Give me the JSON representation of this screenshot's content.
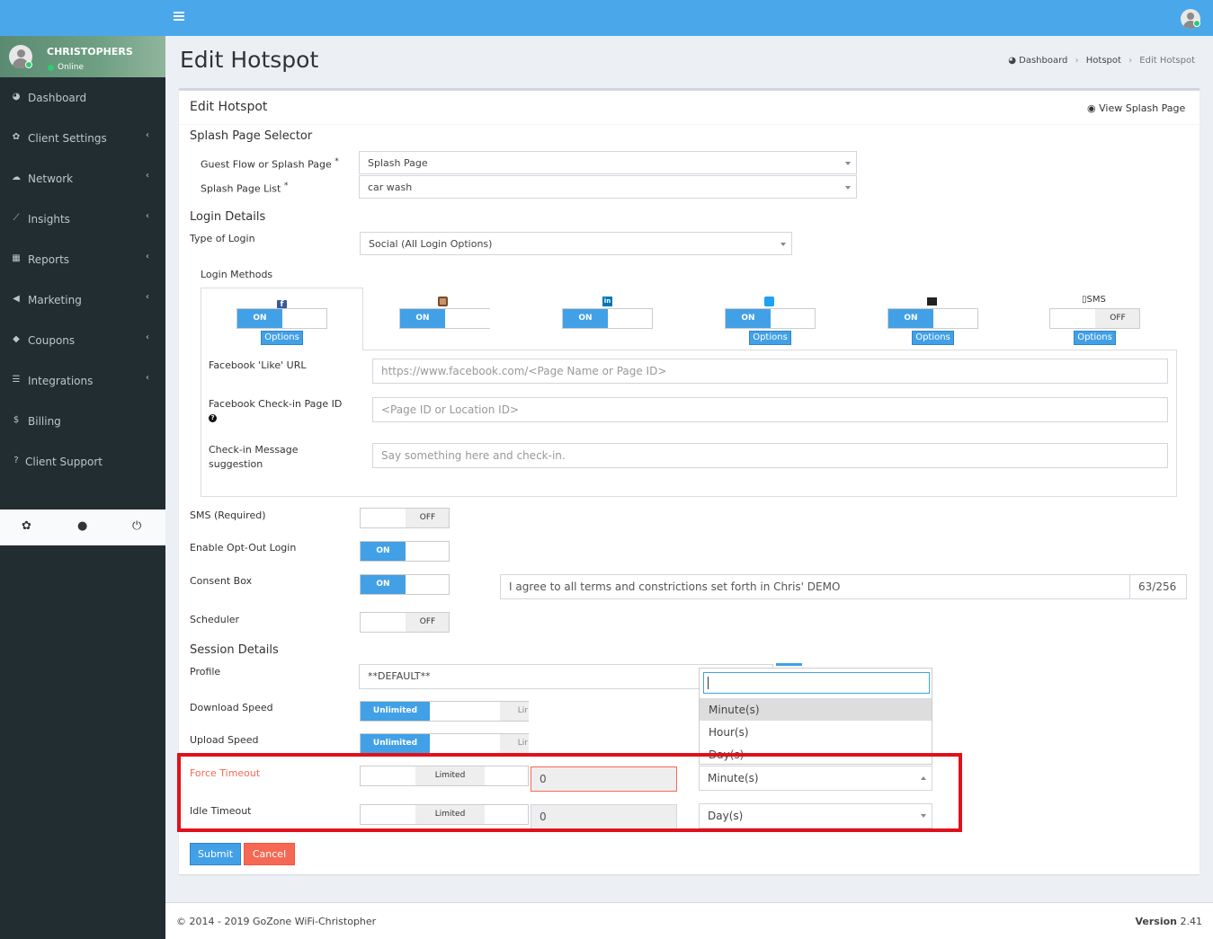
{
  "topbar": {
    "menu_icon": "hamburger-icon",
    "avatar_icon": "user-avatar-icon"
  },
  "sidebar": {
    "user": {
      "name": "CHRISTOPHERS",
      "status": "Online"
    },
    "items": [
      {
        "label": "Dashboard",
        "icon": "dashboard-icon",
        "submenu": false
      },
      {
        "label": "Client Settings",
        "icon": "gear-icon",
        "submenu": true
      },
      {
        "label": "Network",
        "icon": "cloud-icon",
        "submenu": true
      },
      {
        "label": "Insights",
        "icon": "line-chart-icon",
        "submenu": true
      },
      {
        "label": "Reports",
        "icon": "table-icon",
        "submenu": true
      },
      {
        "label": "Marketing",
        "icon": "bullhorn-icon",
        "submenu": true
      },
      {
        "label": "Coupons",
        "icon": "tag-icon",
        "submenu": true
      },
      {
        "label": "Integrations",
        "icon": "list-icon",
        "submenu": true
      },
      {
        "label": "Billing",
        "icon": "dollar-icon",
        "submenu": false
      },
      {
        "label": "Client Support",
        "icon": "question-icon",
        "submenu": false
      }
    ],
    "chevron": "‹",
    "bottom_icons": [
      "gear-icon",
      "user-icon",
      "power-icon"
    ]
  },
  "page": {
    "title": "Edit Hotspot",
    "breadcrumb": {
      "home": "Dashboard",
      "middle": "Hotspot",
      "current": "Edit Hotspot",
      "sep": "›"
    }
  },
  "form": {
    "box_title": "Edit Hotspot",
    "view_splash": "View Splash Page",
    "splash_selector": {
      "heading": "Splash Page Selector",
      "guest_flow_label": "Guest Flow or Splash Page",
      "guest_flow_value": "Splash Page",
      "splash_list_label": "Splash Page List",
      "splash_list_value": "car wash",
      "required_mark": "*"
    },
    "login_details": {
      "heading": "Login Details",
      "type_label": "Type of Login",
      "type_value": "Social (All Login Options)",
      "methods_label": "Login Methods"
    },
    "methods": [
      {
        "name": "facebook",
        "state": "ON",
        "options": "Options",
        "has_options": true
      },
      {
        "name": "instagram",
        "state": "ON",
        "options": "",
        "has_options": false
      },
      {
        "name": "linkedin",
        "state": "ON",
        "options": "",
        "has_options": false
      },
      {
        "name": "twitter",
        "state": "ON",
        "options": "Options",
        "has_options": true
      },
      {
        "name": "email",
        "state": "ON",
        "options": "Options",
        "has_options": true
      },
      {
        "name": "sms",
        "label": "SMS",
        "state": "OFF",
        "options": "Options",
        "has_options": true
      }
    ],
    "facebook": {
      "like_url_label": "Facebook 'Like' URL",
      "like_url_placeholder": "https://www.facebook.com/<Page Name or Page ID>",
      "checkin_label": "Facebook Check-in Page ID",
      "checkin_placeholder": "<Page ID or Location ID>",
      "message_label_1": "Check-in Message",
      "message_label_2": "suggestion",
      "message_placeholder": "Say something here and check-in."
    },
    "sms_required": {
      "label": "SMS (Required)",
      "state": "OFF"
    },
    "opt_out": {
      "label": "Enable Opt-Out Login",
      "state": "ON"
    },
    "consent": {
      "label": "Consent Box",
      "state": "ON",
      "text": "I agree to all terms and constrictions set forth in Chris' DEMO",
      "count": "63/256"
    },
    "scheduler": {
      "label": "Scheduler",
      "state": "OFF"
    },
    "session": {
      "heading": "Session Details",
      "profile_label": "Profile",
      "profile_value": "**DEFAULT**",
      "download_label": "Download Speed",
      "download_value": "Unlimited",
      "download_alt": "Lir",
      "upload_label": "Upload Speed",
      "upload_value": "Unlimited",
      "upload_alt": "Lir",
      "force_timeout_label": "Force Timeout",
      "force_timeout_toggle": "Limited",
      "force_timeout_value": "0",
      "force_timeout_unit": "Minute(s)",
      "idle_timeout_label": "Idle Timeout",
      "idle_timeout_toggle": "Limited",
      "idle_timeout_value": "0",
      "idle_timeout_unit": "Day(s)"
    },
    "dropdown": {
      "search_value": "",
      "options": [
        "Minute(s)",
        "Hour(s)",
        "Day(s)"
      ],
      "selected": "Minute(s)"
    },
    "submit": "Submit",
    "cancel": "Cancel"
  },
  "footer": {
    "copyright": "© 2014 - 2019 GoZone WiFi-Christopher",
    "version_label": "Version",
    "version": "2.41"
  },
  "colors": {
    "primary": "#42a0e6",
    "danger": "#f56954",
    "highlight": "#e0111b",
    "sidebar": "#222d32",
    "topbar": "#4aa8ea"
  }
}
